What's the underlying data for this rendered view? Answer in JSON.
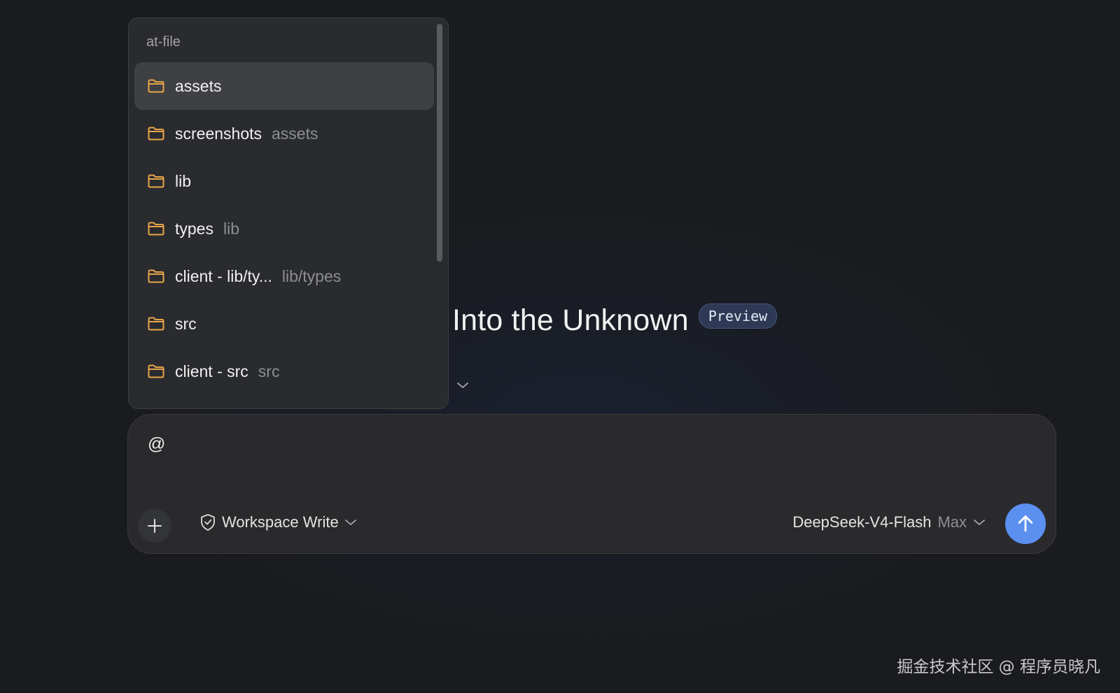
{
  "at_file_popover": {
    "header": "at-file",
    "items": [
      {
        "name": "assets",
        "path": "",
        "icon": "folder-icon",
        "active": true
      },
      {
        "name": "screenshots",
        "path": "assets",
        "icon": "folder-icon"
      },
      {
        "name": "lib",
        "path": "",
        "icon": "folder-icon"
      },
      {
        "name": "types",
        "path": "lib",
        "icon": "folder-icon"
      },
      {
        "name": "client - lib/ty...",
        "path": "lib/types",
        "icon": "folder-icon"
      },
      {
        "name": "src",
        "path": "",
        "icon": "folder-icon"
      },
      {
        "name": "client - src",
        "path": "src",
        "icon": "folder-icon"
      }
    ]
  },
  "main": {
    "title": "Into the Unknown",
    "badge": "Preview"
  },
  "composer": {
    "input_value": "@",
    "add_icon": "plus-icon",
    "mode_icon": "shield-check-icon",
    "mode_label": "Workspace Write",
    "model_name": "DeepSeek-V4-Flash",
    "model_effort": "Max",
    "send_icon": "arrow-up-icon"
  },
  "watermark": "掘金技术社区 @ 程序员晓凡",
  "colors": {
    "folder": "#e8a54a",
    "accent": "#5b8ff0",
    "badge_bg": "#2e3a55"
  }
}
